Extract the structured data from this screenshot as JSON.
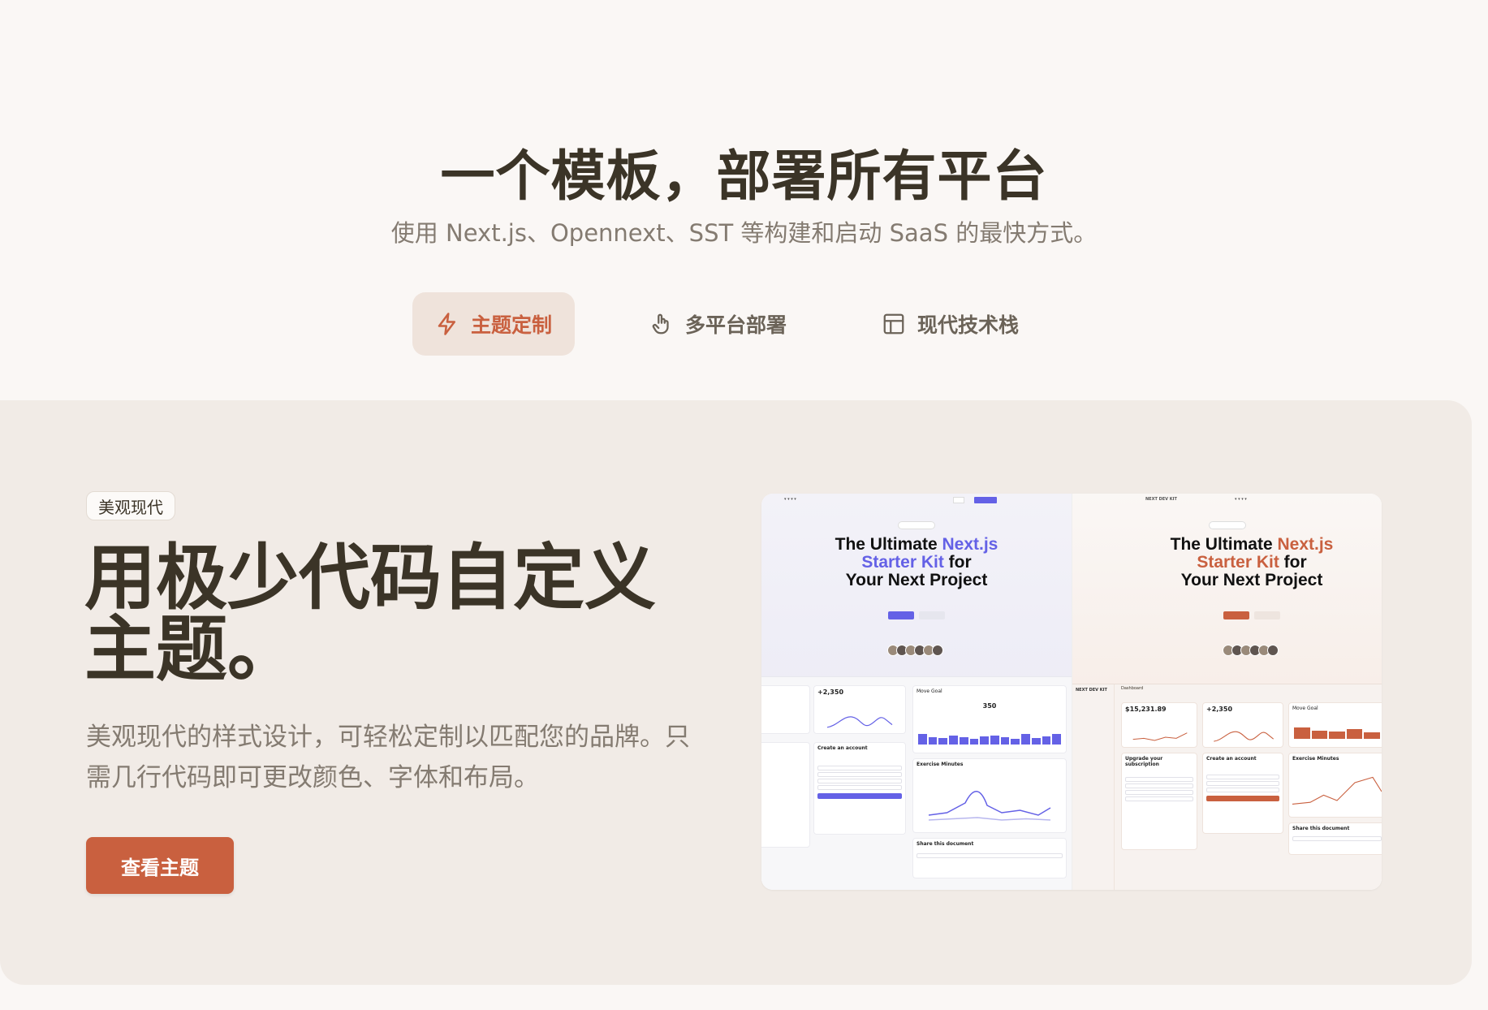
{
  "hero": {
    "title": "一个模板，部署所有平台",
    "subtitle": "使用 Next.js、Opennext、SST 等构建和启动 SaaS 的最快方式。"
  },
  "tabs": [
    {
      "label": "主题定制",
      "icon": "lightning-icon",
      "active": true
    },
    {
      "label": "多平台部署",
      "icon": "pointer-hand-icon",
      "active": false
    },
    {
      "label": "现代技术栈",
      "icon": "layout-icon",
      "active": false
    }
  ],
  "feature": {
    "badge": "美观现代",
    "title": "用极少代码自定义主题。",
    "description": "美观现代的样式设计，可轻松定制以匹配您的品牌。只需几行代码即可更改颜色、字体和布局。",
    "cta_label": "查看主题"
  },
  "preview": {
    "hero_line1_a": "The Ultimate ",
    "hero_line1_b": "Next.js",
    "hero_line2_a": "Starter Kit",
    "hero_line2_b": " for",
    "hero_line3": "Your Next Project",
    "brand": "NEXT DEV KIT",
    "stats": {
      "subscriptions": "+2,350",
      "revenue": "$15,231.89",
      "move_goal": "350"
    },
    "cards": {
      "create_account": "Create an account",
      "exercise_minutes": "Exercise Minutes",
      "share_document": "Share this document",
      "upgrade_subscription": "Upgrade your subscription",
      "dashboard": "Dashboard",
      "move_goal_label": "Move Goal"
    }
  },
  "colors": {
    "accent": "#c9603f",
    "preview_accent_alt": "#6461e6",
    "panel_bg": "#f1ebe6",
    "page_bg": "#faf7f5"
  }
}
